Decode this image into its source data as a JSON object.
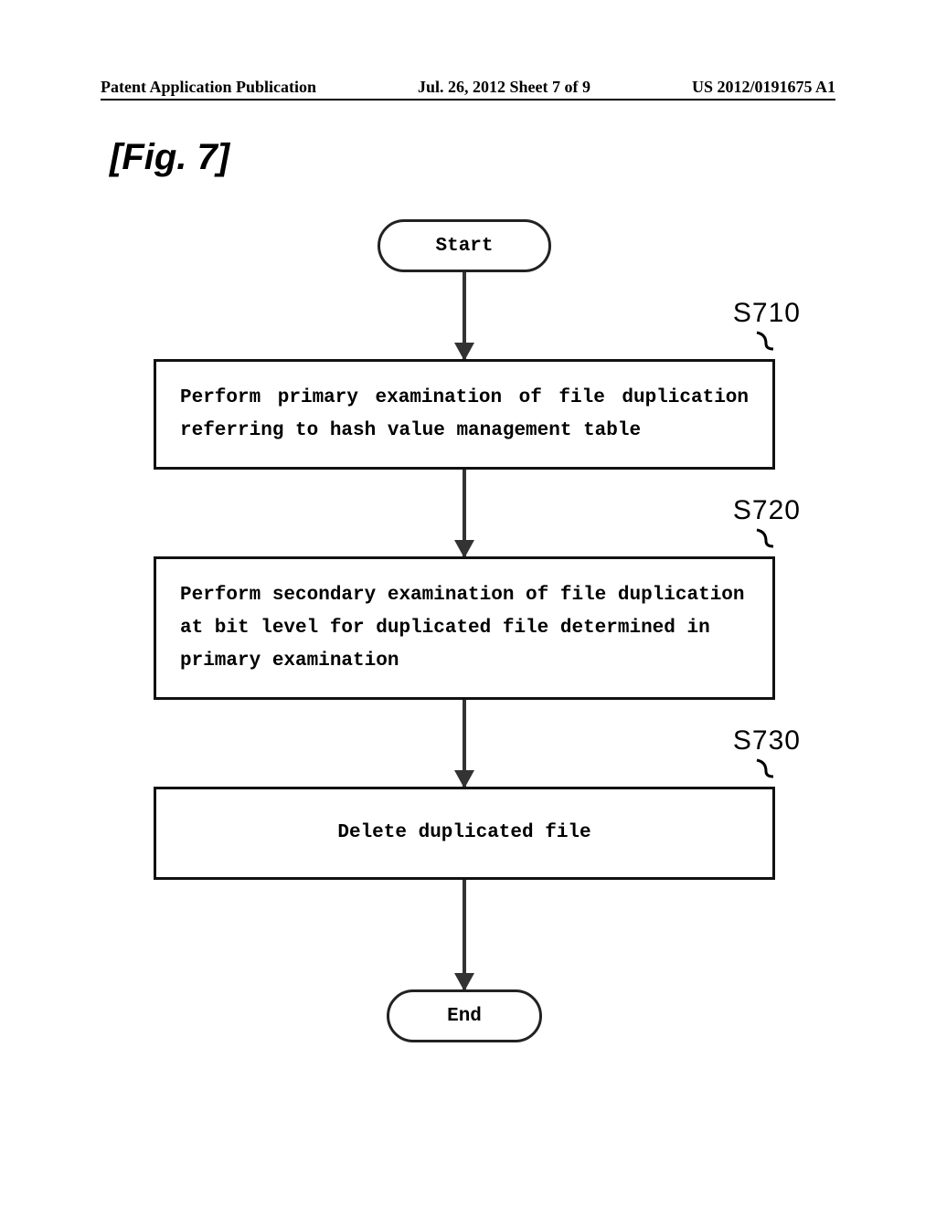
{
  "header": {
    "left": "Patent Application Publication",
    "middle": "Jul. 26, 2012  Sheet 7 of 9",
    "right": "US 2012/0191675 A1"
  },
  "figure_label": "[Fig. 7]",
  "flow": {
    "start": "Start",
    "end": "End",
    "steps": {
      "s710": {
        "ref": "S710",
        "text": "Perform primary examination of file duplication referring to hash value management table"
      },
      "s720": {
        "ref": "S720",
        "text": "Perform secondary examination of file duplication at bit level for duplicated file determined in primary examination"
      },
      "s730": {
        "ref": "S730",
        "text": "Delete duplicated file"
      }
    }
  }
}
